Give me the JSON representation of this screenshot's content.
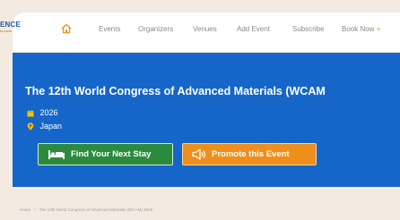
{
  "logo": {
    "top": "ENCE",
    "bottom": "fo.com"
  },
  "nav": {
    "items": [
      {
        "label": "Events"
      },
      {
        "label": "Organizers"
      },
      {
        "label": "Venues"
      },
      {
        "label": "Add Event"
      },
      {
        "label": "Subscribe"
      },
      {
        "label": "Book Now"
      }
    ],
    "book_now_suffix": "+"
  },
  "hero": {
    "title": "The 12th World Congress of Advanced Materials (WCAM",
    "year": "2026",
    "location": "Japan",
    "bg_color": "#1666c9"
  },
  "buttons": {
    "find_stay": "Find Your Next Stay",
    "promote": "Promote this Event"
  },
  "breadcrumb": {
    "home": "Home",
    "separator": "/",
    "current": "The 12th World Congress of Advanced Materials (WCAM) 2026"
  },
  "icons": {
    "home": "home-icon",
    "calendar": "calendar-icon",
    "location": "location-pin-icon",
    "bed": "bed-icon",
    "megaphone": "megaphone-icon"
  },
  "colors": {
    "accent_orange": "#ef8f1b",
    "accent_green": "#2b8a3e",
    "brand_blue": "#1e5ba8",
    "date_icon": "#f2c400",
    "location_icon": "#f5b400"
  }
}
